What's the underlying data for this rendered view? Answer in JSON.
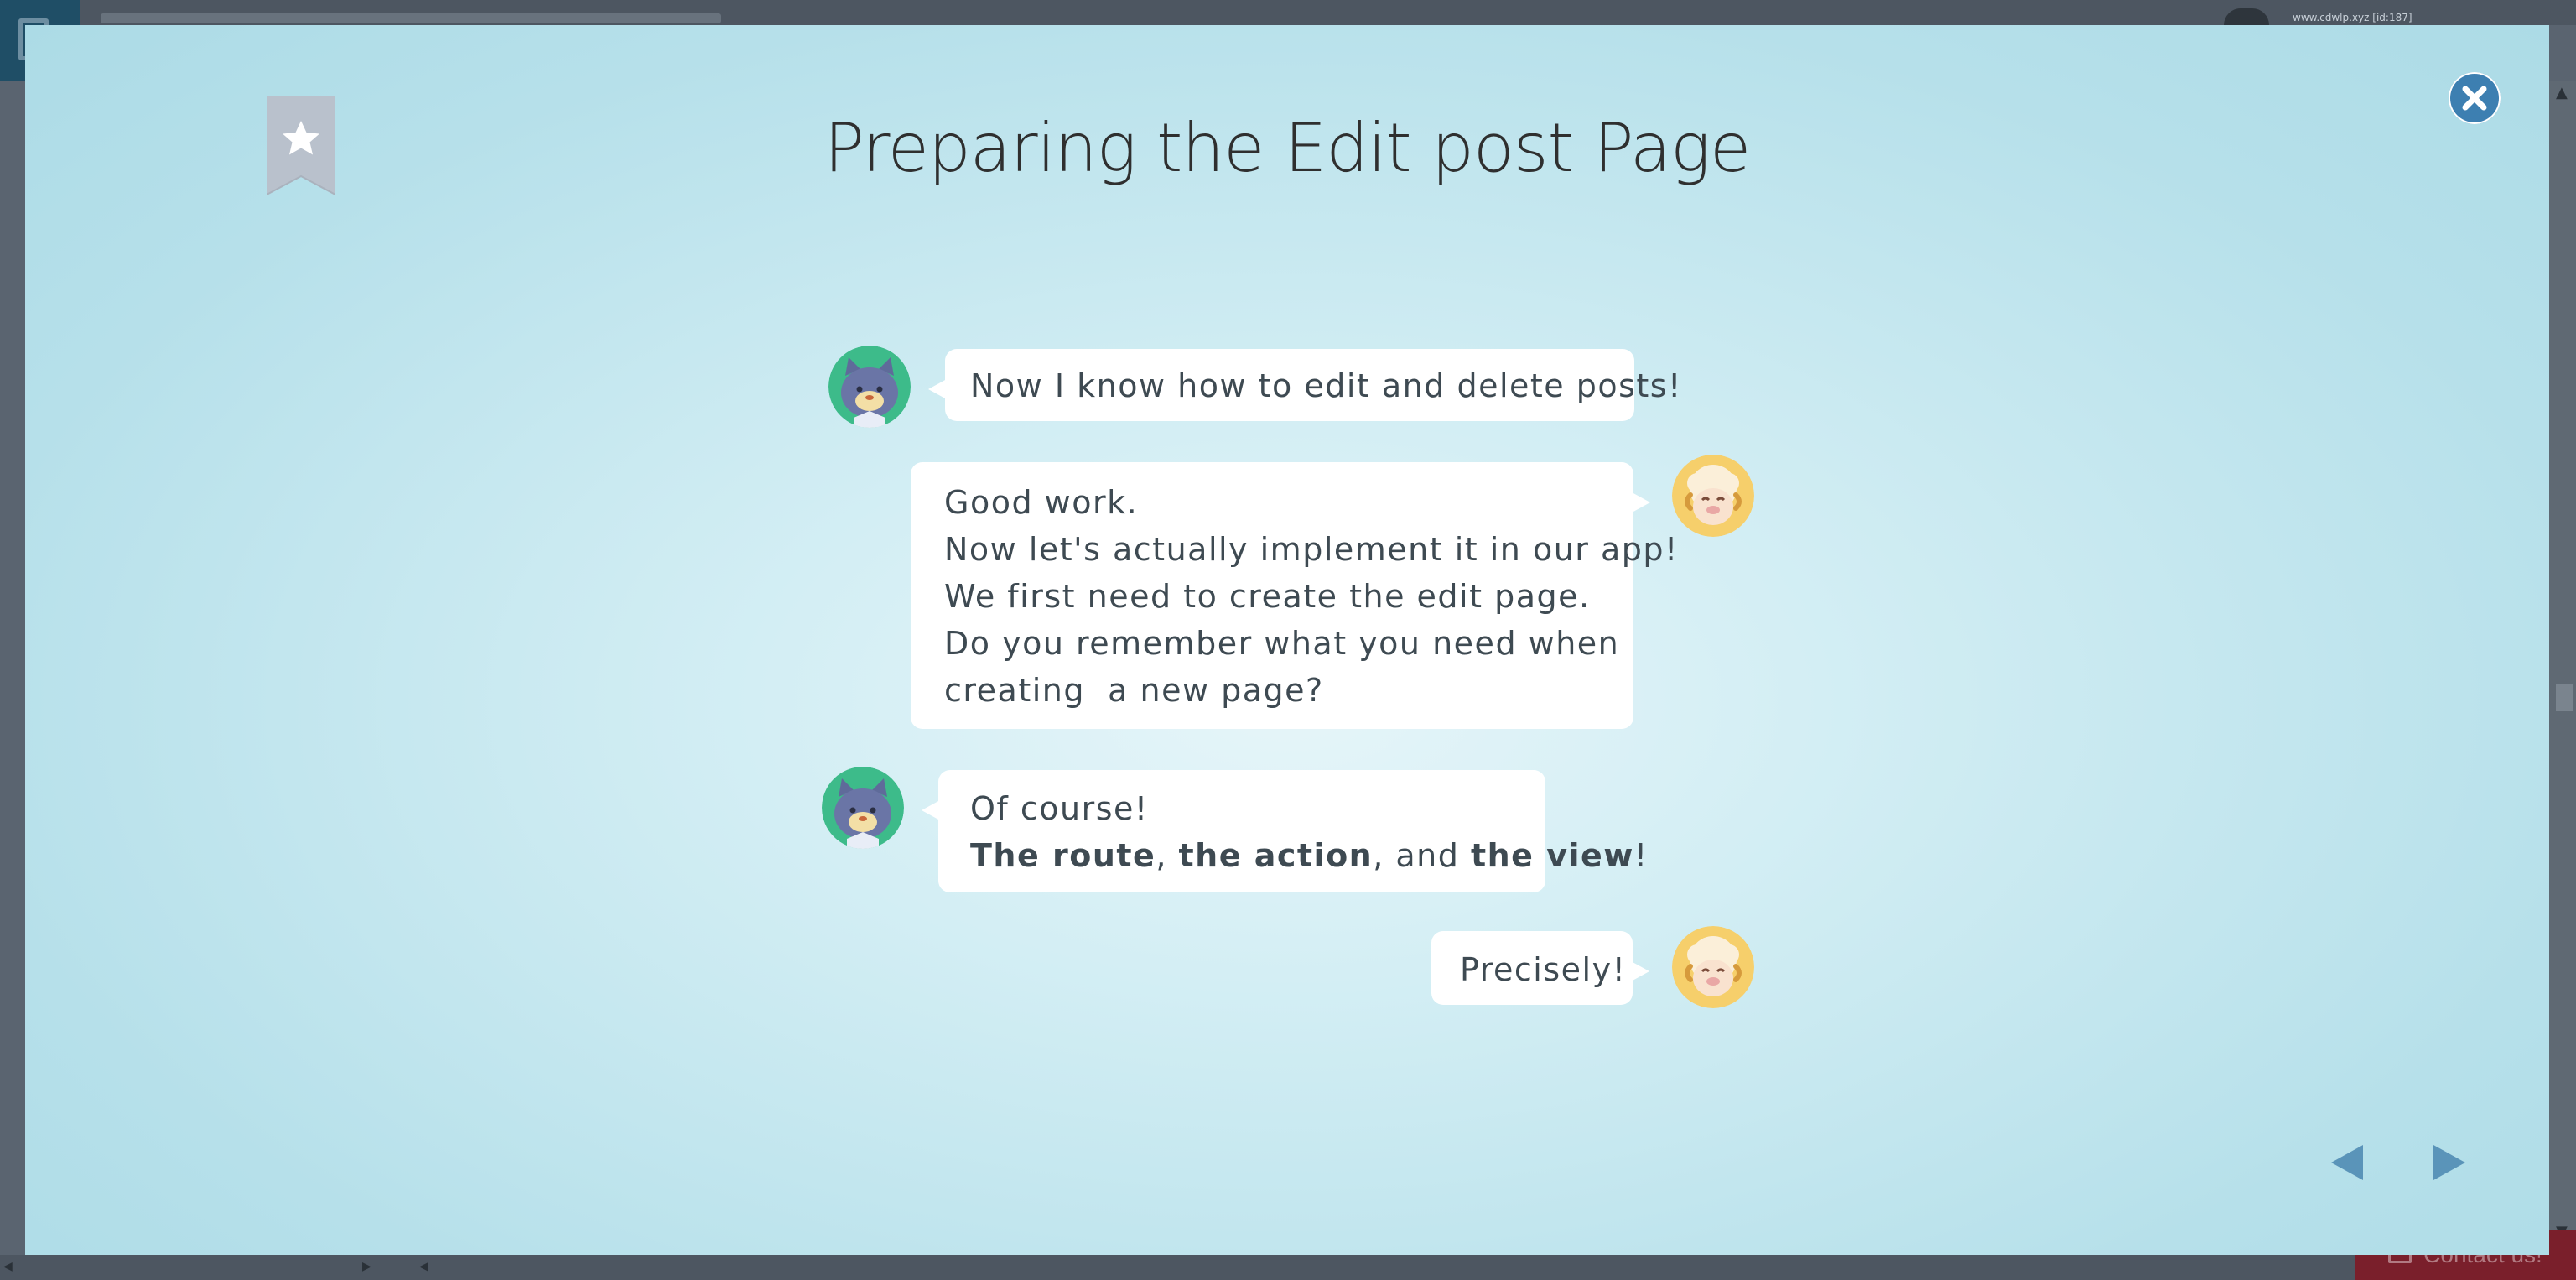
{
  "background": {
    "user_label": "www.cdwlp.xyz [id:187]",
    "contact_label": "Contact us!"
  },
  "modal": {
    "title": "Preparing the Edit post Page",
    "close_icon": "close-icon",
    "bookmark_icon": "bookmark-star-icon",
    "messages": [
      {
        "speaker": "cat",
        "side": "left",
        "lines": [
          "Now I know how to edit and delete posts!"
        ]
      },
      {
        "speaker": "sheep",
        "side": "right",
        "lines": [
          "Good work.",
          "Now let's actually implement it in our app!",
          "We first need to create the edit page.",
          "Do you remember what you need when",
          "creating  a new page?"
        ]
      },
      {
        "speaker": "cat",
        "side": "left",
        "line1": "Of course!",
        "line2": {
          "part1": "The route",
          "sep1": ", ",
          "part2": "the action",
          "sep2": ", and ",
          "part3": "the view",
          "end": "!"
        }
      },
      {
        "speaker": "sheep",
        "side": "right",
        "lines": [
          "Precisely!"
        ]
      }
    ],
    "nav": {
      "prev_icon": "triangle-left-icon",
      "next_icon": "triangle-right-icon"
    }
  },
  "colors": {
    "accent": "#3d7fb1",
    "title_text": "#2f2f2f",
    "bubble_text": "#3e4a52",
    "nav_arrow": "#5a94b9"
  }
}
